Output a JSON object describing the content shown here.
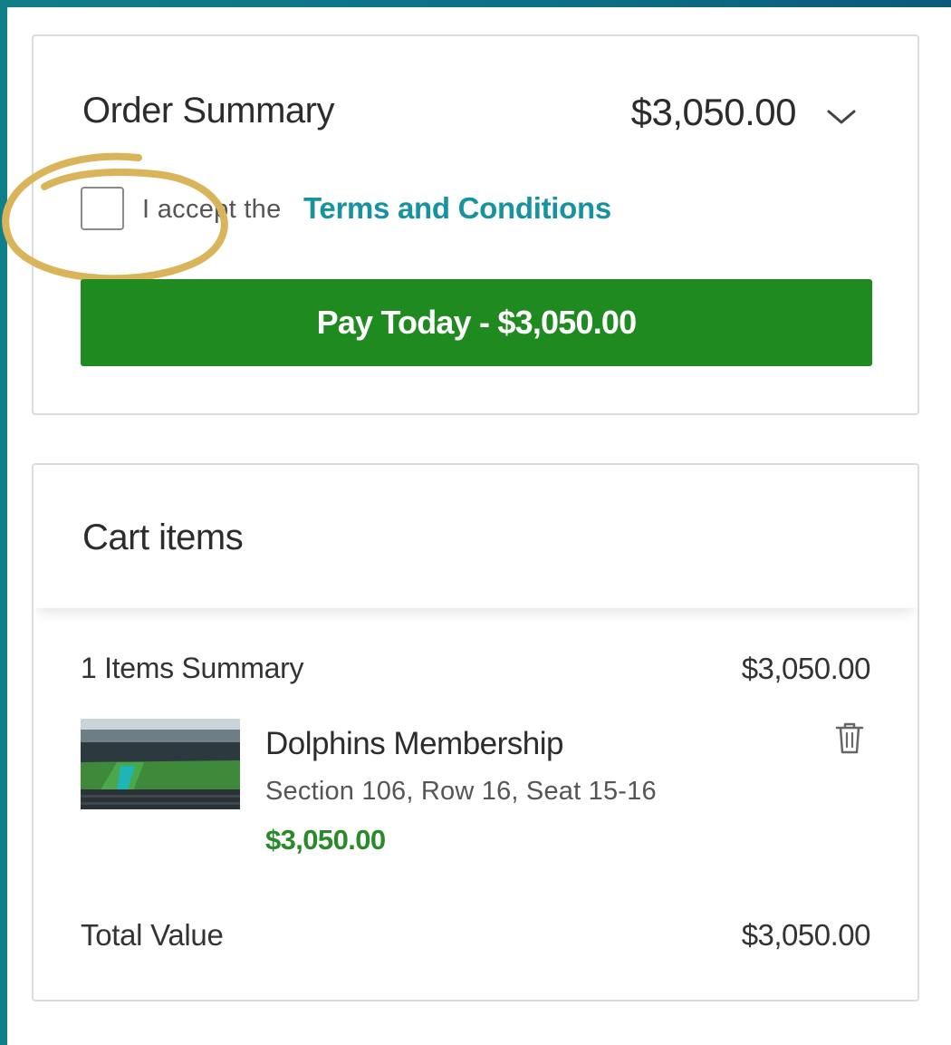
{
  "order_summary": {
    "title": "Order Summary",
    "total": "$3,050.00",
    "accept_prefix": "I accept the",
    "terms_link": "Terms and Conditions",
    "pay_button": "Pay Today - $3,050.00"
  },
  "cart": {
    "title": "Cart items",
    "items_summary_label": "1 Items Summary",
    "items_summary_total": "$3,050.00",
    "items": [
      {
        "name": "Dolphins Membership",
        "seat": "Section 106, Row 16, Seat 15-16",
        "price": "$3,050.00",
        "thumbnail_icon": "stadium-image"
      }
    ],
    "total_label": "Total Value",
    "total_value": "$3,050.00"
  },
  "colors": {
    "accent_link": "#17939f",
    "pay_button": "#1f8a1f",
    "price_green": "#2a8a2a",
    "highlight_ring": "#d9b45a",
    "background_gradient_start": "#0f7f8a"
  }
}
